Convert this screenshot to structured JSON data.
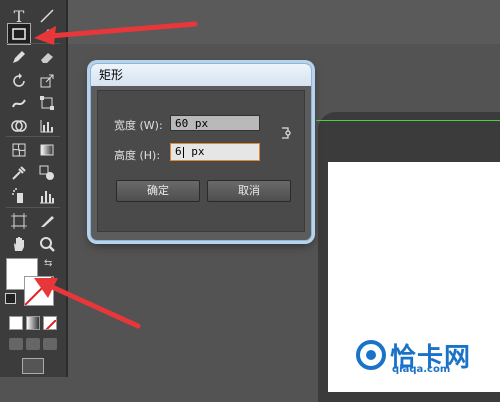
{
  "colors": {
    "toolbar_bg": "#3c3c3c",
    "canvas_bg": "#535353",
    "dialog_title_bg": "#dce8f4",
    "input_focus_border": "#e08a33",
    "annotation_arrow": "#e8373a",
    "guide_line": "#48d048",
    "watermark": "#1a73c8"
  },
  "toolbar": {
    "tools": [
      {
        "icon": "type-icon",
        "glyph": "T"
      },
      {
        "icon": "line-segment-icon"
      },
      {
        "icon": "rectangle-tool-icon",
        "active": true
      },
      {
        "icon": "eraser-icon"
      },
      {
        "icon": "pencil-icon"
      },
      {
        "icon": "rotate-icon"
      },
      {
        "icon": "scale-icon"
      },
      {
        "icon": "warp-icon"
      },
      {
        "icon": "free-transform-icon"
      },
      {
        "icon": "shape-builder-icon"
      },
      {
        "icon": "graph-icon"
      },
      {
        "icon": "mesh-icon"
      },
      {
        "icon": "gradient-icon"
      },
      {
        "icon": "eyedropper-icon"
      },
      {
        "icon": "blend-icon"
      },
      {
        "icon": "symbol-sprayer-icon"
      },
      {
        "icon": "column-graph-icon"
      },
      {
        "icon": "artboard-icon"
      },
      {
        "icon": "slice-icon"
      },
      {
        "icon": "hand-icon"
      },
      {
        "icon": "zoom-icon"
      }
    ],
    "fill_stroke": {
      "fill": "#ffffff",
      "stroke": "none"
    }
  },
  "dialog": {
    "title": "矩形",
    "width_label": "宽度 (W):",
    "width_value": "60 px",
    "height_label": "高度 (H):",
    "height_value_before_caret": "6",
    "height_value_after_caret": " px",
    "ok_label": "确定",
    "cancel_label": "取消"
  },
  "watermark": {
    "text": "恰卡网",
    "url": "qiaqa.com"
  }
}
